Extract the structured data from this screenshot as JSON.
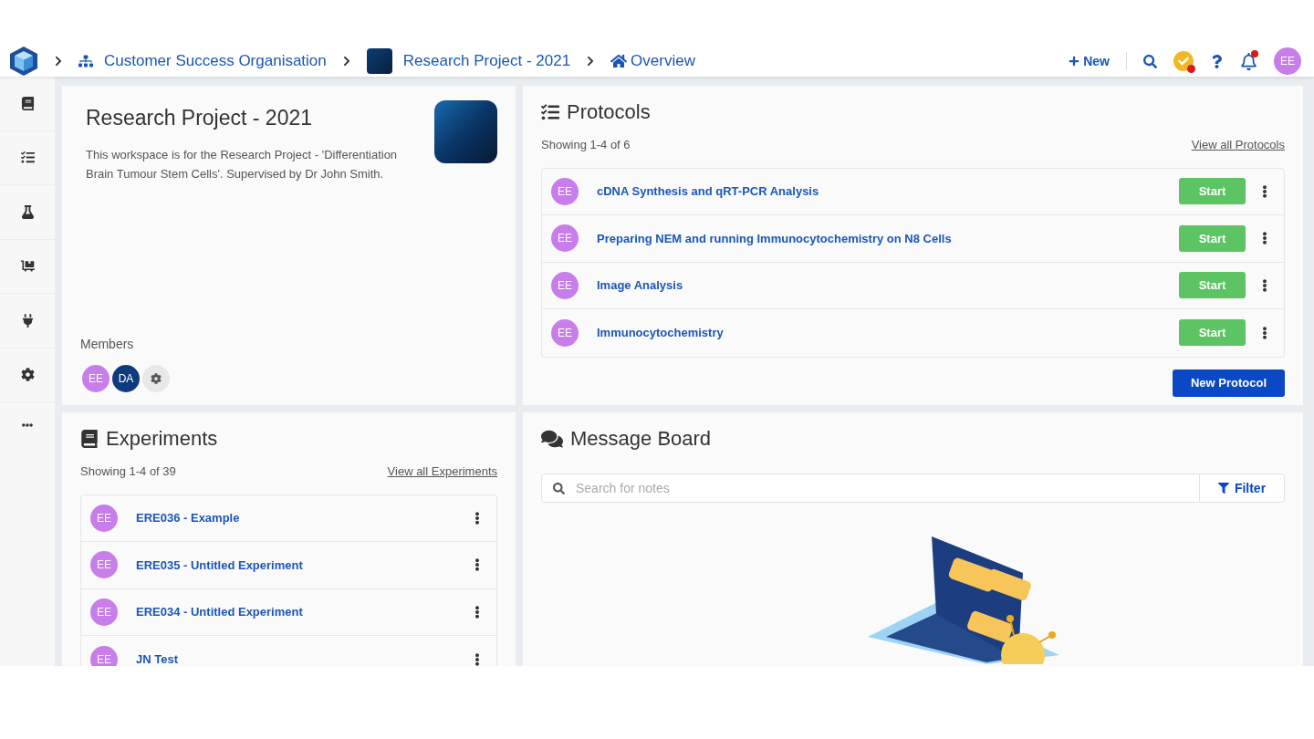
{
  "breadcrumbs": [
    {
      "kind": "org",
      "label": "Customer Success Organisation"
    },
    {
      "kind": "project",
      "label": "Research Project - 2021"
    },
    {
      "kind": "page",
      "label": "Overview"
    }
  ],
  "header": {
    "new_button": "New",
    "tasks_alert": true,
    "notifications_alert": true,
    "user_initials": "EE"
  },
  "project": {
    "title": "Research Project - 2021",
    "description": "This workspace is for the Research Project - 'Differentiation Brain Tumour Stem Cells'. Supervised by Dr John Smith.",
    "members_label": "Members",
    "members": [
      {
        "initials": "EE",
        "color": "#c77dea"
      },
      {
        "initials": "DA",
        "color": "#0f3a7d"
      }
    ]
  },
  "protocols": {
    "title": "Protocols",
    "showing": "Showing 1-4 of 6",
    "view_all": "View all Protocols",
    "items": [
      {
        "initials": "EE",
        "name": "cDNA Synthesis and qRT-PCR Analysis",
        "action": "Start"
      },
      {
        "initials": "EE",
        "name": "Preparing NEM and running Immunocytochemistry on N8 Cells",
        "action": "Start"
      },
      {
        "initials": "EE",
        "name": "Image Analysis",
        "action": "Start"
      },
      {
        "initials": "EE",
        "name": "Immunocytochemistry",
        "action": "Start"
      }
    ],
    "new_button": "New Protocol"
  },
  "experiments": {
    "title": "Experiments",
    "showing": "Showing 1-4 of 39",
    "view_all": "View all Experiments",
    "items": [
      {
        "initials": "EE",
        "name": "ERE036 - Example"
      },
      {
        "initials": "EE",
        "name": "ERE035 - Untitled Experiment"
      },
      {
        "initials": "EE",
        "name": "ERE034 - Untitled Experiment"
      },
      {
        "initials": "EE",
        "name": "JN Test"
      }
    ]
  },
  "message_board": {
    "title": "Message Board",
    "search": {
      "placeholder": "Search for notes"
    },
    "filter": "Filter"
  }
}
